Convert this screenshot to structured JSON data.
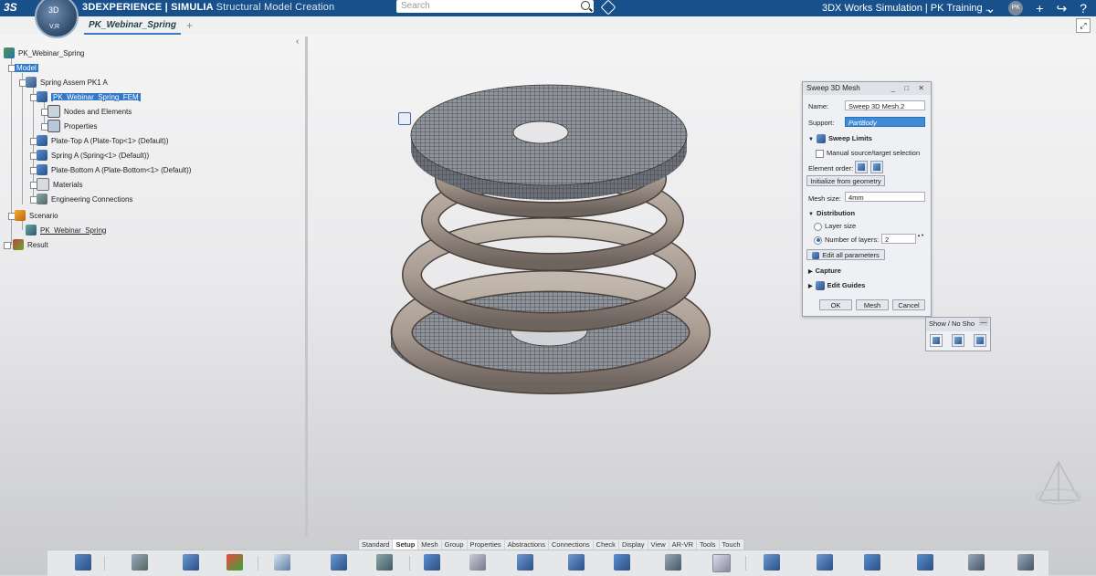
{
  "topbar": {
    "brand_product": "3DEXPERIENCE | SIMULIA",
    "brand_app": "Structural Model Creation",
    "search_placeholder": "Search",
    "workspace": "3DX Works Simulation | PK Training ...",
    "compass_top": "3D",
    "compass_bottom": "V,R",
    "avatar_initials": "PK"
  },
  "tabs": {
    "active": "PK_Webinar_Spring",
    "add": "+"
  },
  "tree": {
    "collapse": "‹",
    "items": [
      {
        "label": "PK_Webinar_Spring"
      },
      {
        "label": "Model"
      },
      {
        "label": "Spring Assem PK1 A"
      },
      {
        "label": "PK_Webinar_Spring_FEM"
      },
      {
        "label": "Nodes and Elements"
      },
      {
        "label": "Properties"
      },
      {
        "label": "Plate-Top A (Plate-Top<1> (Default))"
      },
      {
        "label": "Spring A (Spring<1> (Default))"
      },
      {
        "label": "Plate-Bottom A (Plate-Bottom<1> (Default))"
      },
      {
        "label": "Materials"
      },
      {
        "label": "Engineering Connections"
      },
      {
        "label": "Scenario"
      },
      {
        "label": "PK_Webinar_Spring"
      },
      {
        "label": "Result"
      }
    ]
  },
  "dialog": {
    "title": "Sweep 3D Mesh",
    "title_buttons": "_ □ ✕",
    "name_label": "Name:",
    "name_value": "Sweep 3D Mesh.2",
    "support_label": "Support:",
    "support_value": "PartBody",
    "sweep_limits": "Sweep Limits",
    "manual_selection": "Manual source/target selection",
    "element_order": "Element order:",
    "init_geometry": "Initialize from geometry",
    "mesh_size_label": "Mesh size:",
    "mesh_size_value": "4mm",
    "distribution": "Distribution",
    "layer_size": "Layer size",
    "number_of_layers": "Number of layers:",
    "layers_value": "2",
    "spin": "▲▼",
    "edit_all": "Edit all parameters",
    "capture": "Capture",
    "edit_guides": "Edit Guides",
    "ok": "OK",
    "mesh": "Mesh",
    "cancel": "Cancel"
  },
  "show_panel": {
    "title": "Show / No Sho",
    "close": "—"
  },
  "action_tabs": [
    "Standard",
    "Setup",
    "Mesh",
    "Group",
    "Properties",
    "Abstractions",
    "Connections",
    "Check",
    "Display",
    "View",
    "AR-VR",
    "Tools",
    "Touch"
  ],
  "action_tab_active": "Setup",
  "colors": {
    "topbar": "#17508a",
    "selection": "#3478c8",
    "spring": "#a99c92",
    "mesh_plate": "#5c5f66"
  }
}
